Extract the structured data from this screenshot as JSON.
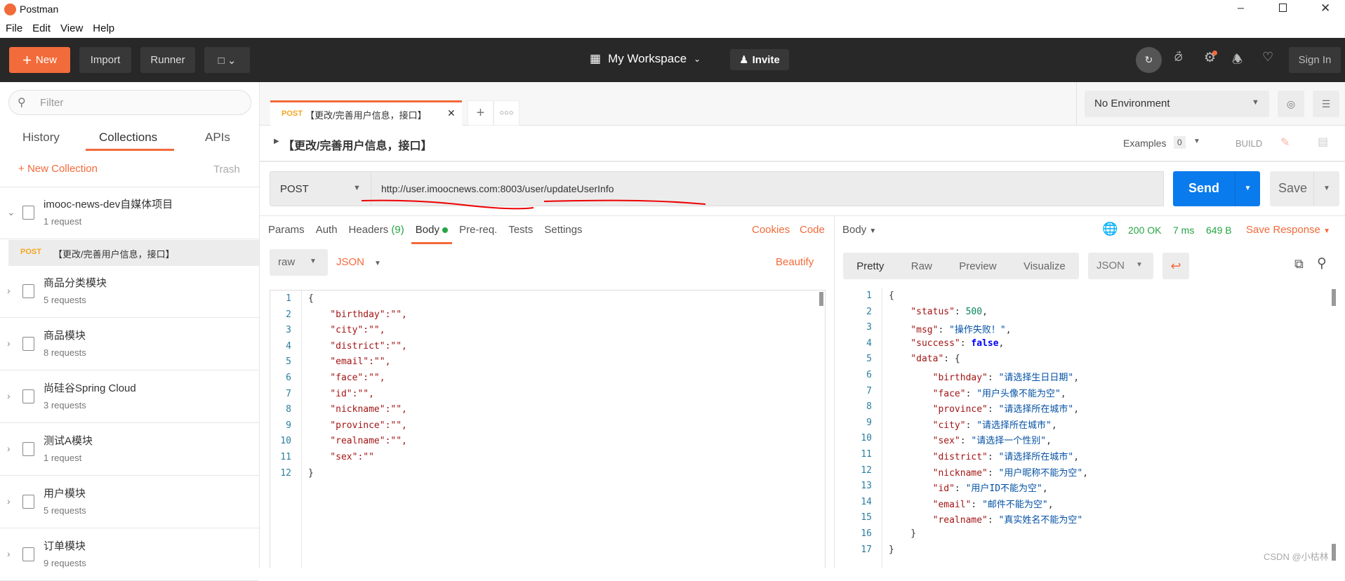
{
  "app": {
    "title": "Postman",
    "menu": [
      "File",
      "Edit",
      "View",
      "Help"
    ]
  },
  "toolbar": {
    "new": "New",
    "import": "Import",
    "runner": "Runner",
    "workspace": "My Workspace",
    "invite": "Invite",
    "sign_in": "Sign In"
  },
  "sidebar": {
    "filter_placeholder": "Filter",
    "tabs": [
      "History",
      "Collections",
      "APIs"
    ],
    "new_collection": "New Collection",
    "trash": "Trash",
    "collections": [
      {
        "name": "imooc-news-dev自媒体项目",
        "count": "1 request"
      },
      {
        "name": "商品分类模块",
        "count": "5 requests"
      },
      {
        "name": "商品模块",
        "count": "8 requests"
      },
      {
        "name": "尚硅谷Spring Cloud",
        "count": "3 requests"
      },
      {
        "name": "测试A模块",
        "count": "1 request"
      },
      {
        "name": "用户模块",
        "count": "5 requests"
      },
      {
        "name": "订单模块",
        "count": "9 requests"
      }
    ],
    "selected_request": {
      "method": "POST",
      "name": "【更改/完善用户信息，接口】"
    }
  },
  "tab": {
    "method": "POST",
    "name": "【更改/完善用户信息，接口】"
  },
  "environment": "No Environment",
  "request": {
    "title": "【更改/完善用户信息，接口】",
    "examples": "Examples",
    "examples_count": "0",
    "build": "BUILD",
    "method": "POST",
    "url": "http://user.imoocnews.com:8003/user/updateUserInfo",
    "send": "Send",
    "save": "Save",
    "tabs": {
      "params": "Params",
      "auth": "Auth",
      "headers": "Headers",
      "headers_count": "(9)",
      "body": "Body",
      "prereq": "Pre-req.",
      "tests": "Tests",
      "settings": "Settings",
      "cookies": "Cookies",
      "code": "Code"
    },
    "body_mode": "raw",
    "body_type": "JSON",
    "beautify": "Beautify",
    "body_lines": [
      "{",
      "    \"birthday\":\"\",",
      "    \"city\":\"\",",
      "    \"district\":\"\",",
      "    \"email\":\"\",",
      "    \"face\":\"\",",
      "    \"id\":\"\",",
      "    \"nickname\":\"\",",
      "    \"province\":\"\",",
      "    \"realname\":\"\",",
      "    \"sex\":\"\"",
      "}"
    ]
  },
  "response": {
    "label": "Body",
    "status": "200 OK",
    "time": "7 ms",
    "size": "649 B",
    "save": "Save Response",
    "views": [
      "Pretty",
      "Raw",
      "Preview",
      "Visualize"
    ],
    "format": "JSON",
    "lines": [
      [
        [
          "p",
          "{"
        ]
      ],
      [
        [
          "k",
          "    \"status\""
        ],
        [
          "p",
          ": "
        ],
        [
          "n",
          "500"
        ],
        [
          "p",
          ","
        ]
      ],
      [
        [
          "k",
          "    \"msg\""
        ],
        [
          "p",
          ": "
        ],
        [
          "s",
          "\"操作失败！\""
        ],
        [
          "p",
          ","
        ]
      ],
      [
        [
          "k",
          "    \"success\""
        ],
        [
          "p",
          ": "
        ],
        [
          "b",
          "false"
        ],
        [
          "p",
          ","
        ]
      ],
      [
        [
          "k",
          "    \"data\""
        ],
        [
          "p",
          ": {"
        ]
      ],
      [
        [
          "k",
          "        \"birthday\""
        ],
        [
          "p",
          ": "
        ],
        [
          "s",
          "\"请选择生日日期\""
        ],
        [
          "p",
          ","
        ]
      ],
      [
        [
          "k",
          "        \"face\""
        ],
        [
          "p",
          ": "
        ],
        [
          "s",
          "\"用户头像不能为空\""
        ],
        [
          "p",
          ","
        ]
      ],
      [
        [
          "k",
          "        \"province\""
        ],
        [
          "p",
          ": "
        ],
        [
          "s",
          "\"请选择所在城市\""
        ],
        [
          "p",
          ","
        ]
      ],
      [
        [
          "k",
          "        \"city\""
        ],
        [
          "p",
          ": "
        ],
        [
          "s",
          "\"请选择所在城市\""
        ],
        [
          "p",
          ","
        ]
      ],
      [
        [
          "k",
          "        \"sex\""
        ],
        [
          "p",
          ": "
        ],
        [
          "s",
          "\"请选择一个性别\""
        ],
        [
          "p",
          ","
        ]
      ],
      [
        [
          "k",
          "        \"district\""
        ],
        [
          "p",
          ": "
        ],
        [
          "s",
          "\"请选择所在城市\""
        ],
        [
          "p",
          ","
        ]
      ],
      [
        [
          "k",
          "        \"nickname\""
        ],
        [
          "p",
          ": "
        ],
        [
          "s",
          "\"用户昵称不能为空\""
        ],
        [
          "p",
          ","
        ]
      ],
      [
        [
          "k",
          "        \"id\""
        ],
        [
          "p",
          ": "
        ],
        [
          "s",
          "\"用户ID不能为空\""
        ],
        [
          "p",
          ","
        ]
      ],
      [
        [
          "k",
          "        \"email\""
        ],
        [
          "p",
          ": "
        ],
        [
          "s",
          "\"邮件不能为空\""
        ],
        [
          "p",
          ","
        ]
      ],
      [
        [
          "k",
          "        \"realname\""
        ],
        [
          "p",
          ": "
        ],
        [
          "s",
          "\"真实姓名不能为空\""
        ]
      ],
      [
        [
          "p",
          "    }"
        ]
      ],
      [
        [
          "p",
          "}"
        ]
      ]
    ]
  },
  "watermark": "CSDN @小枯林",
  "colors": {
    "accent": "#f26b3a",
    "send": "#097bed",
    "toolbar": "#282828"
  }
}
